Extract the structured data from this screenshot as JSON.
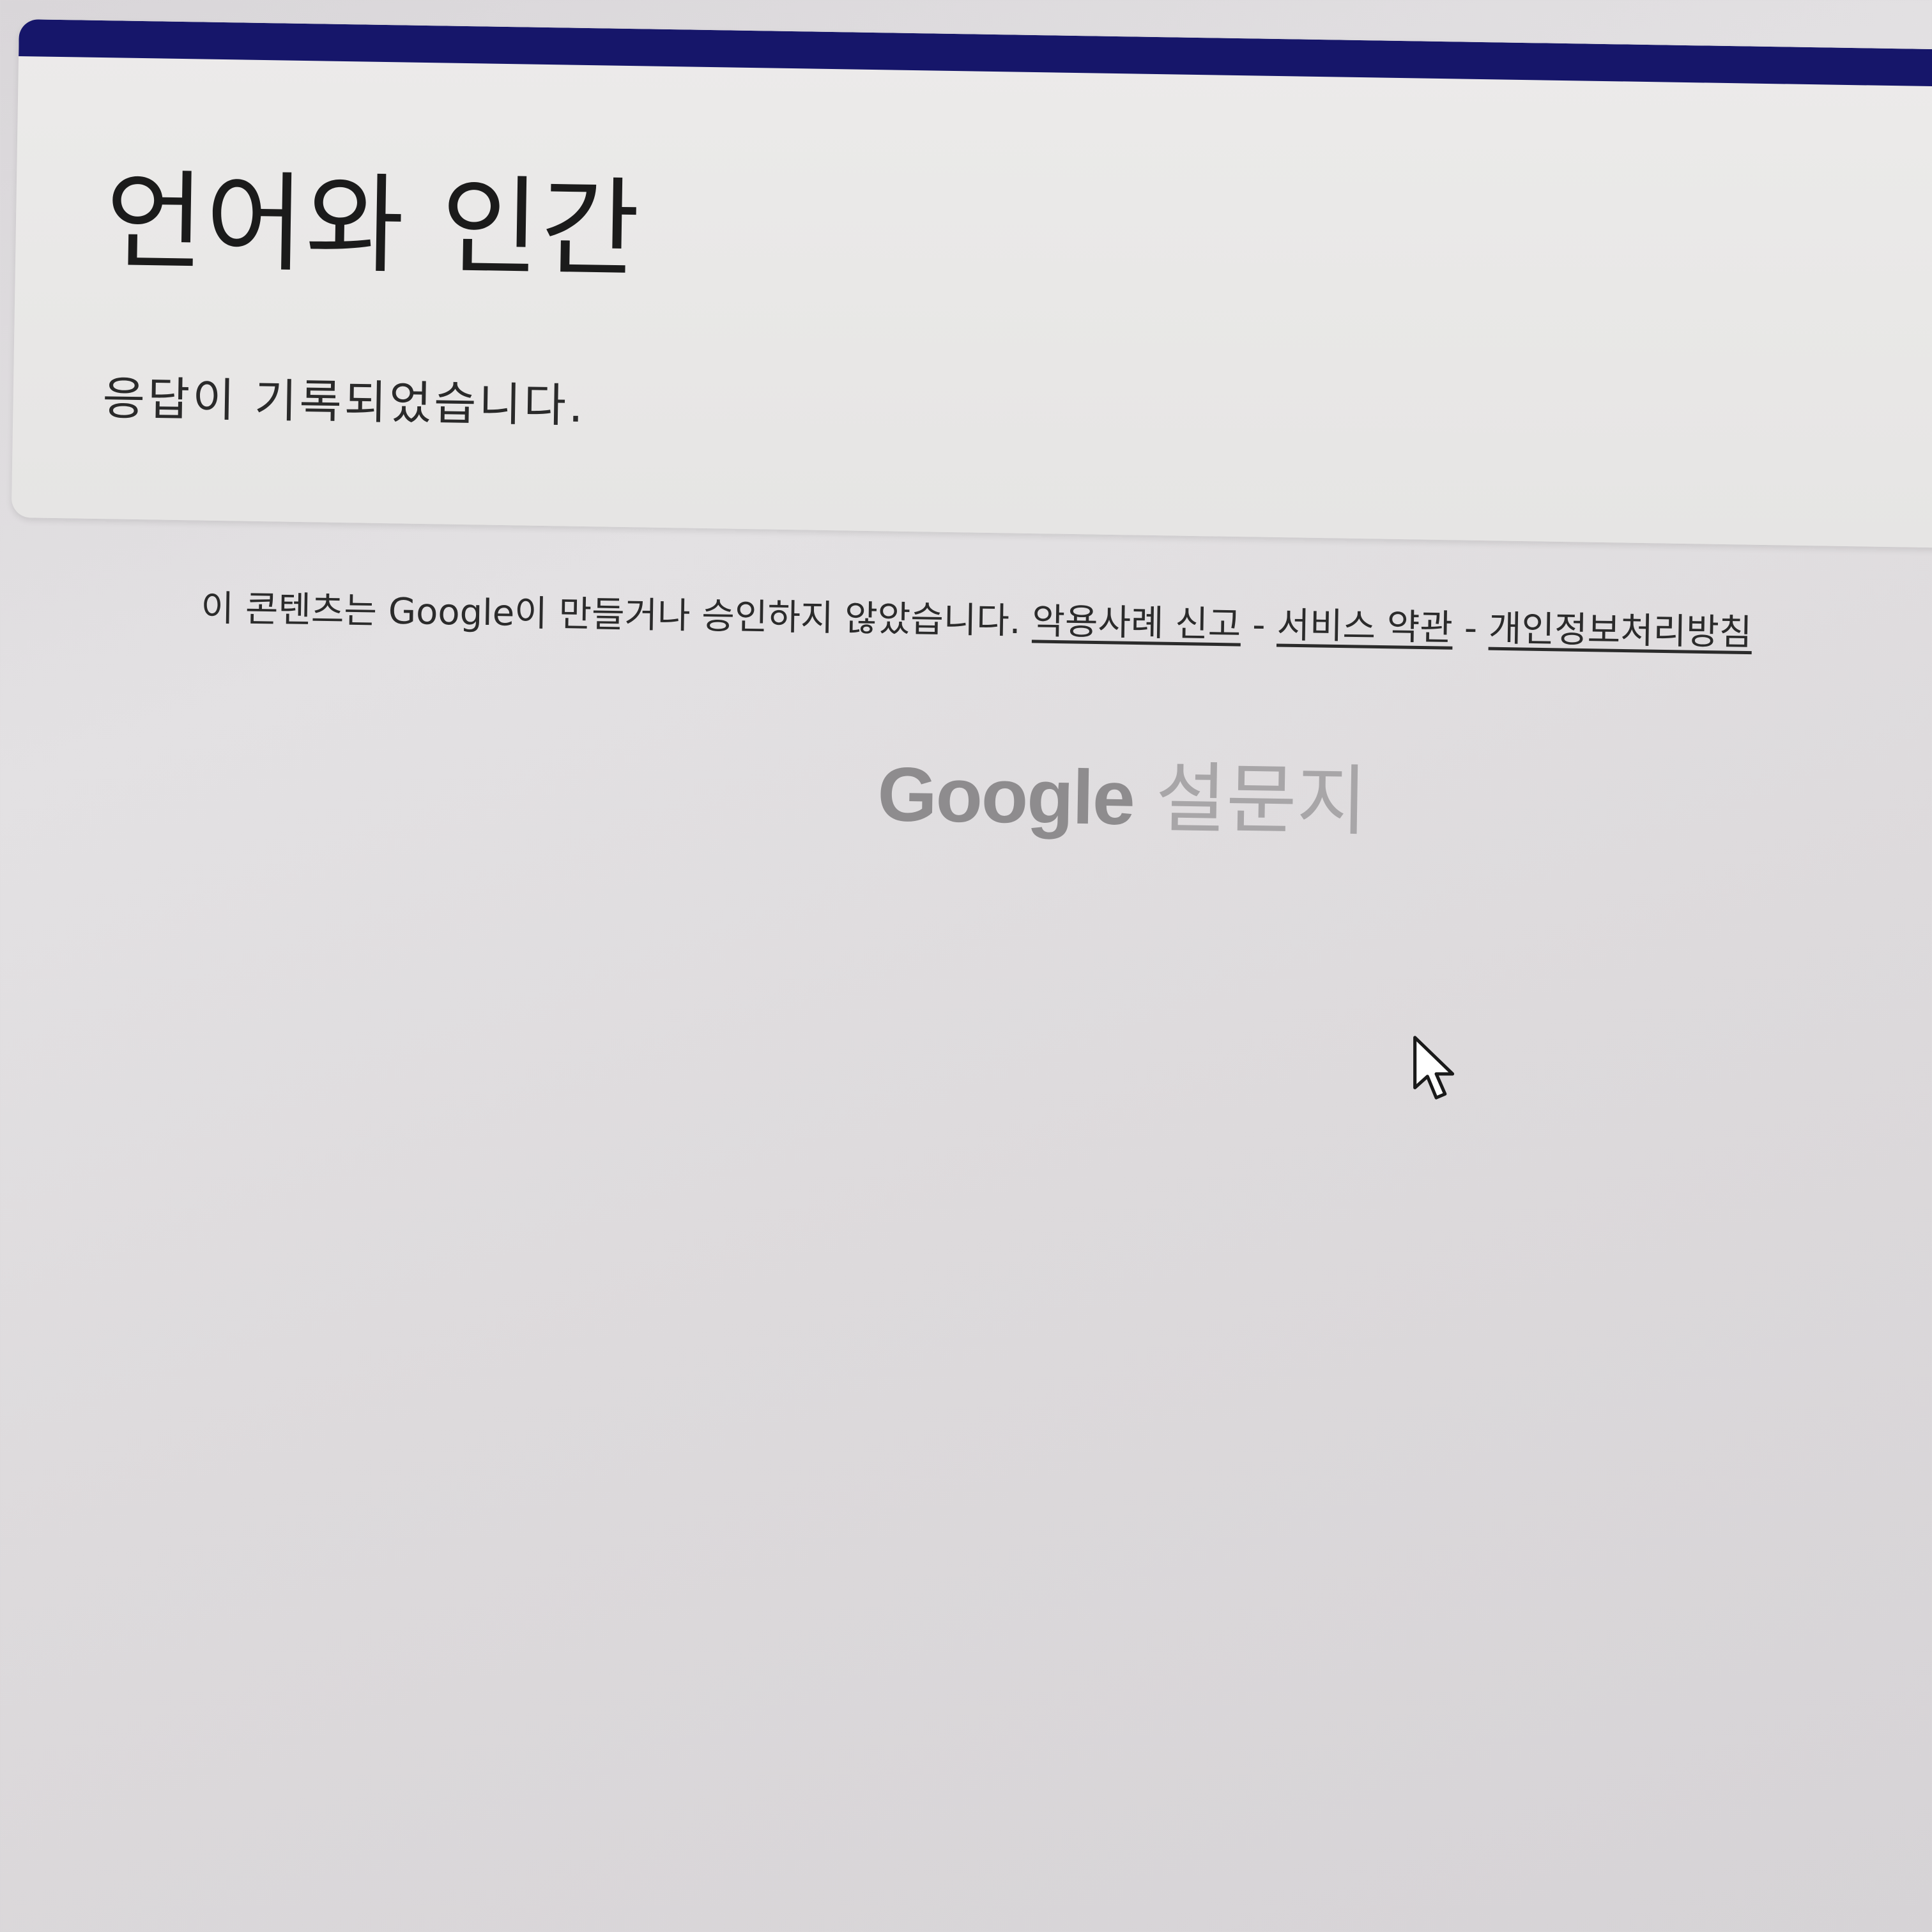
{
  "form": {
    "title": "언어와 인간",
    "confirmation": "응답이 기록되었습니다."
  },
  "footer": {
    "disclaimer": "이 콘텐츠는 Google이 만들거나 승인하지 않았습니다.",
    "links": {
      "report_abuse": "악용사례 신고",
      "terms": "서비스 약관",
      "privacy": "개인정보처리방침"
    },
    "separator": "-"
  },
  "brand": {
    "google": "Google",
    "product": "설문지"
  },
  "colors": {
    "accent": "#16166a",
    "card": "#ecebea",
    "background": "#dedbde"
  },
  "icons": {
    "cursor": "mouse-pointer-icon"
  }
}
